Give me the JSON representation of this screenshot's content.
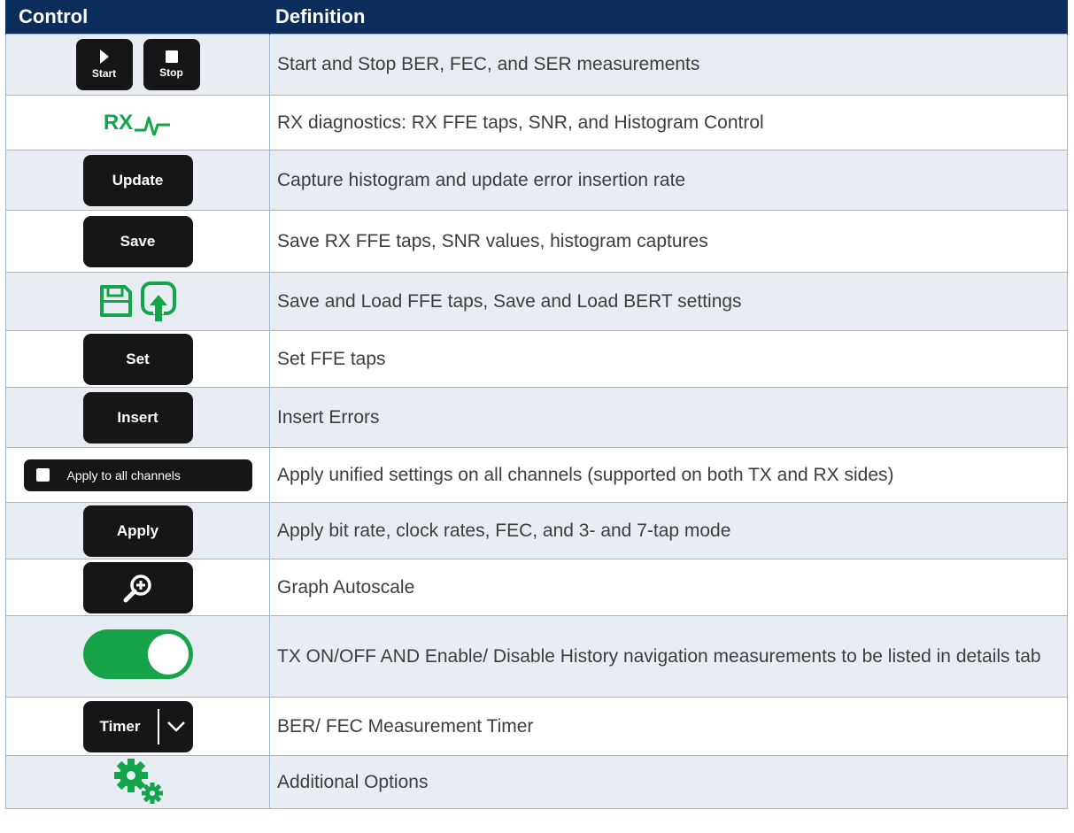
{
  "header": {
    "control": "Control",
    "definition": "Definition"
  },
  "rows": [
    {
      "start_label": "Start",
      "stop_label": "Stop",
      "definition": "Start and Stop BER, FEC, and SER measurements"
    },
    {
      "rx_label": "RX",
      "definition": "RX diagnostics: RX FFE taps, SNR, and Histogram Control"
    },
    {
      "button_label": "Update",
      "definition": "Capture histogram and update error insertion rate"
    },
    {
      "button_label": "Save",
      "definition": "Save RX FFE taps, SNR values, histogram captures"
    },
    {
      "icons": [
        "save-icon",
        "load-icon"
      ],
      "definition": "Save and Load FFE taps, Save and Load BERT settings"
    },
    {
      "button_label": "Set",
      "definition": "Set FFE taps"
    },
    {
      "button_label": "Insert",
      "definition": "Insert Errors"
    },
    {
      "button_label": "Apply to all channels",
      "definition": "Apply unified settings on all channels (supported on both TX and RX sides)"
    },
    {
      "button_label": "Apply",
      "definition": "Apply bit rate, clock rates, FEC, and 3- and 7-tap mode"
    },
    {
      "icon": "zoom-in-icon",
      "definition": "Graph Autoscale"
    },
    {
      "icon": "toggle-switch",
      "definition": "TX ON/OFF AND Enable/ Disable History navigation measurements to be listed in details tab"
    },
    {
      "button_label": "Timer",
      "definition": "BER/ FEC Measurement Timer"
    },
    {
      "icon": "gears-icon",
      "definition": "Additional Options"
    }
  ],
  "colors": {
    "header_bg": "#0b2d5b",
    "accent_green": "#13a54a",
    "button_bg": "#161616"
  }
}
